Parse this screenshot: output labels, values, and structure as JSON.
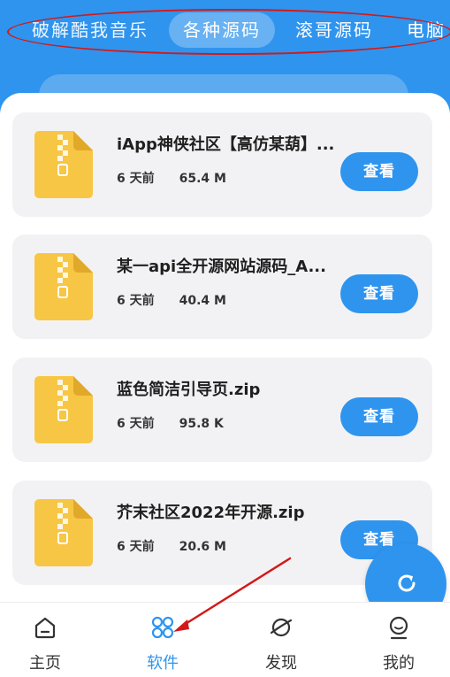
{
  "colors": {
    "accent": "#2f94ee",
    "card_bg": "#f2f2f4",
    "zip_icon": "#f7c644",
    "annotation": "#d11a1a"
  },
  "top_tabs": [
    {
      "label": "破解酷我音乐",
      "selected": false
    },
    {
      "label": "各种源码",
      "selected": true
    },
    {
      "label": "滚哥源码",
      "selected": false
    },
    {
      "label": "电脑",
      "selected": false
    }
  ],
  "files": [
    {
      "title": "iApp神侠社区【高仿某葫】...",
      "date": "6 天前",
      "size": "65.4 M",
      "button": "查看",
      "icon": "zip-file-icon"
    },
    {
      "title": "某一api全开源网站源码_A...",
      "date": "6 天前",
      "size": "40.4 M",
      "button": "查看",
      "icon": "zip-file-icon"
    },
    {
      "title": "蓝色简洁引导页.zip",
      "date": "6 天前",
      "size": "95.8 K",
      "button": "查看",
      "icon": "zip-file-icon"
    },
    {
      "title": "芥末社区2022年开源.zip",
      "date": "6 天前",
      "size": "20.6 M",
      "button": "查看",
      "icon": "zip-file-icon"
    }
  ],
  "fab": {
    "icon": "refresh-icon"
  },
  "bottom_nav": [
    {
      "label": "主页",
      "icon": "home-icon",
      "active": false
    },
    {
      "label": "软件",
      "icon": "apps-icon",
      "active": true
    },
    {
      "label": "发现",
      "icon": "planet-icon",
      "active": false
    },
    {
      "label": "我的",
      "icon": "smiley-profile-icon",
      "active": false
    }
  ]
}
